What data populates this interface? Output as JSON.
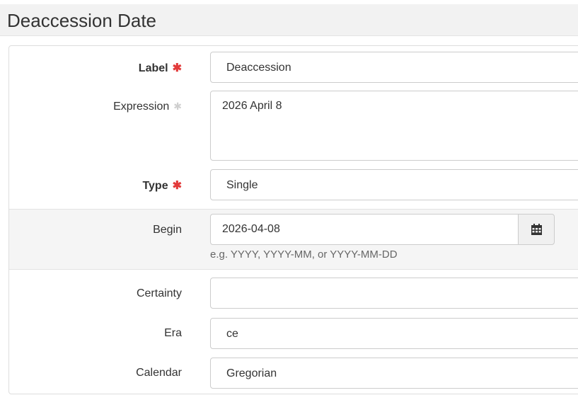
{
  "header": {
    "title": "Deaccession Date"
  },
  "form": {
    "label": {
      "label": "Label",
      "required_mark": "✱",
      "value": "Deaccession"
    },
    "expression": {
      "label": "Expression",
      "optional_mark": "✱",
      "value": "2026 April 8"
    },
    "type": {
      "label": "Type",
      "required_mark": "✱",
      "value": "Single"
    },
    "begin": {
      "label": "Begin",
      "value": "2026-04-08",
      "hint": "e.g. YYYY, YYYY-MM, or YYYY-MM-DD",
      "button_icon": "calendar-icon"
    },
    "certainty": {
      "label": "Certainty",
      "value": ""
    },
    "era": {
      "label": "Era",
      "value": "ce"
    },
    "calendar": {
      "label": "Calendar",
      "value": "Gregorian"
    }
  },
  "colors": {
    "required": "#e23a3a",
    "border": "#cccccc",
    "header_bg": "#f2f2f2"
  }
}
